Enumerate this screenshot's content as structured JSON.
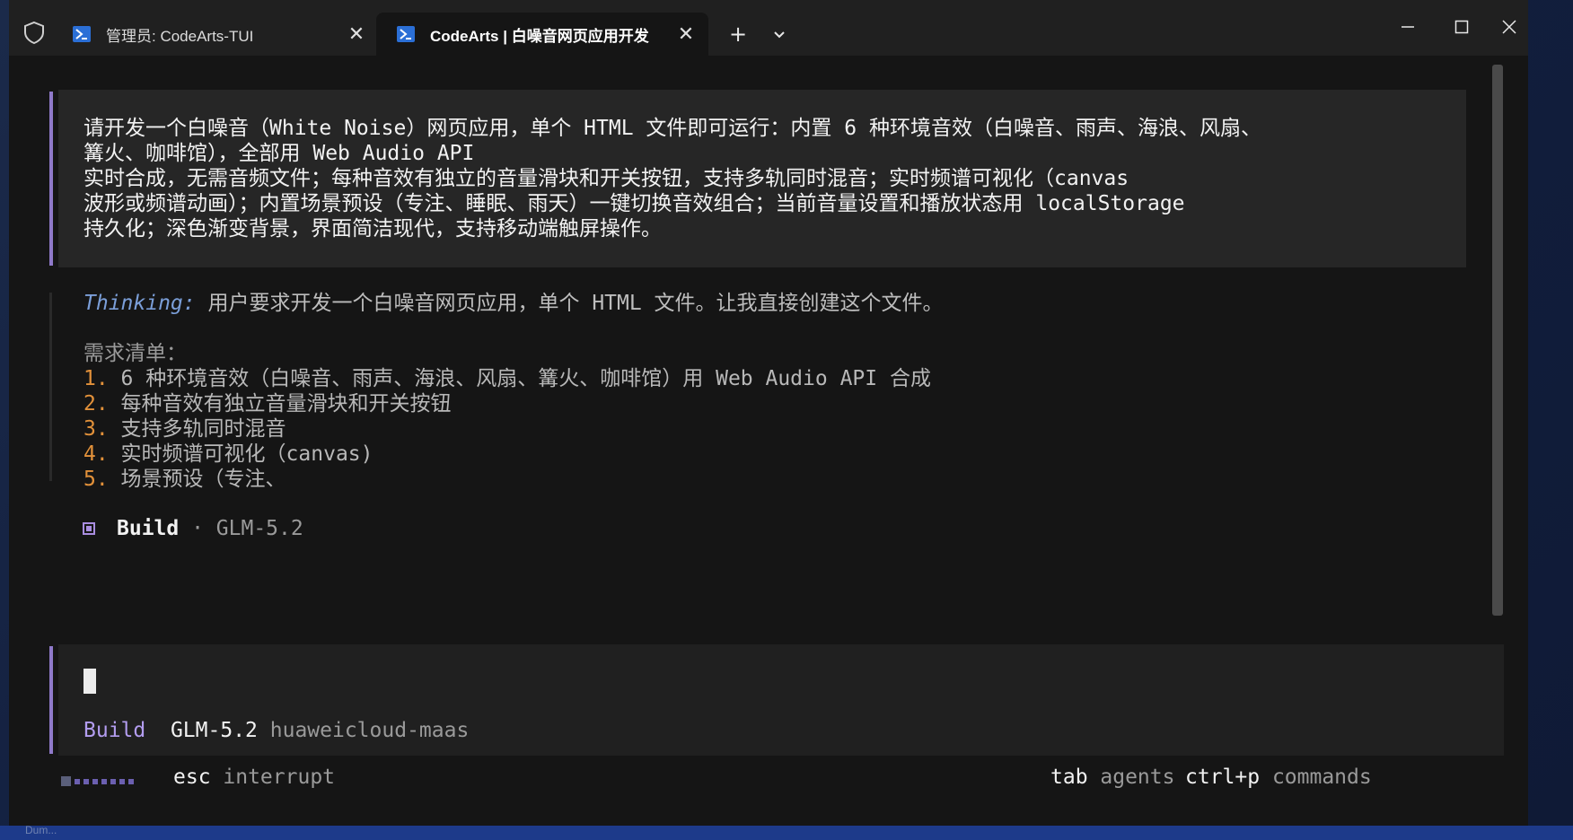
{
  "titlebar": {
    "tabs": [
      {
        "label": "管理员: CodeArts-TUI"
      },
      {
        "label": "CodeArts | 白噪音网页应用开发"
      }
    ]
  },
  "prompt": {
    "lines": [
      "请开发一个白噪音（White Noise）网页应用，单个 HTML 文件即可运行：内置 6 种环境音效（白噪音、雨声、海浪、风扇、",
      "篝火、咖啡馆），全部用 Web Audio API",
      "实时合成，无需音频文件；每种音效有独立的音量滑块和开关按钮，支持多轨同时混音；实时频谱可视化（canvas",
      "波形或频谱动画）；内置场景预设（专注、睡眠、雨天）一键切换音效组合；当前音量设置和播放状态用 localStorage",
      "持久化；深色渐变背景，界面简洁现代，支持移动端触屏操作。"
    ]
  },
  "thinking": {
    "label": "Thinking:",
    "text": " 用户要求开发一个白噪音网页应用，单个 HTML 文件。让我直接创建这个文件。",
    "list_title": "需求清单：",
    "items": [
      {
        "num": "1.",
        "text": " 6 种环境音效（白噪音、雨声、海浪、风扇、篝火、咖啡馆）用 Web Audio API 合成"
      },
      {
        "num": "2.",
        "text": " 每种音效有独立音量滑块和开关按钮"
      },
      {
        "num": "3.",
        "text": " 支持多轨同时混音"
      },
      {
        "num": "4.",
        "text": " 实时频谱可视化（canvas)"
      },
      {
        "num": "5.",
        "text": " 场景预设（专注、"
      }
    ]
  },
  "status": {
    "mode": "Build",
    "separator": " · ",
    "model": "GLM-5.2"
  },
  "input": {
    "mode": "Build",
    "model": "GLM-5.2",
    "provider": "huaweicloud-maas"
  },
  "footer": {
    "esc_key": "esc",
    "esc_label": " interrupt",
    "tab_key": "tab",
    "tab_label": " agents",
    "cmd_key": "ctrl+p",
    "cmd_label": " commands"
  },
  "background": {
    "label": "Dum..."
  }
}
